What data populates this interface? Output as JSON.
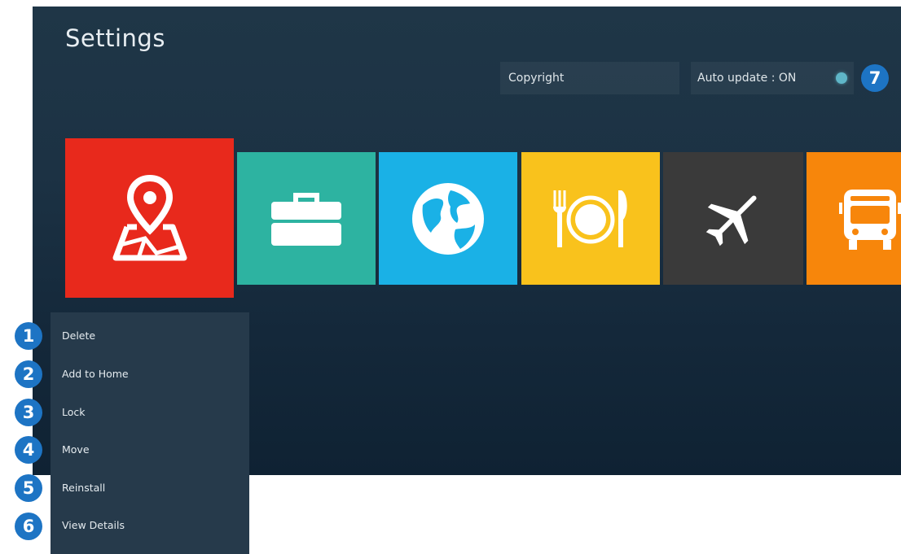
{
  "page": {
    "title": "Settings"
  },
  "top_bar": {
    "copyright_label": "Copyright",
    "auto_update_label": "Auto update : ON",
    "auto_update_indicator_color": "#5fb6c8",
    "callout": "7"
  },
  "tiles": [
    {
      "icon": "map-pin-icon",
      "color": "#e8291c",
      "state": "focused"
    },
    {
      "icon": "briefcase-icon",
      "color": "#2db3a1"
    },
    {
      "icon": "globe-icon",
      "color": "#1ab1e6"
    },
    {
      "icon": "restaurant-icon",
      "color": "#f9c21c"
    },
    {
      "icon": "airplane-icon",
      "color": "#3a3a3a"
    },
    {
      "icon": "bus-icon",
      "color": "#f7860b"
    }
  ],
  "menu": {
    "items": [
      {
        "label": "Delete",
        "callout": "1"
      },
      {
        "label": "Add to Home",
        "callout": "2"
      },
      {
        "label": "Lock",
        "callout": "3"
      },
      {
        "label": "Move",
        "callout": "4"
      },
      {
        "label": "Reinstall",
        "callout": "5"
      },
      {
        "label": "View Details",
        "callout": "6"
      }
    ]
  },
  "colors": {
    "callout": "#1d74c4",
    "background": "#1c3244",
    "menu": "#263a4b"
  }
}
